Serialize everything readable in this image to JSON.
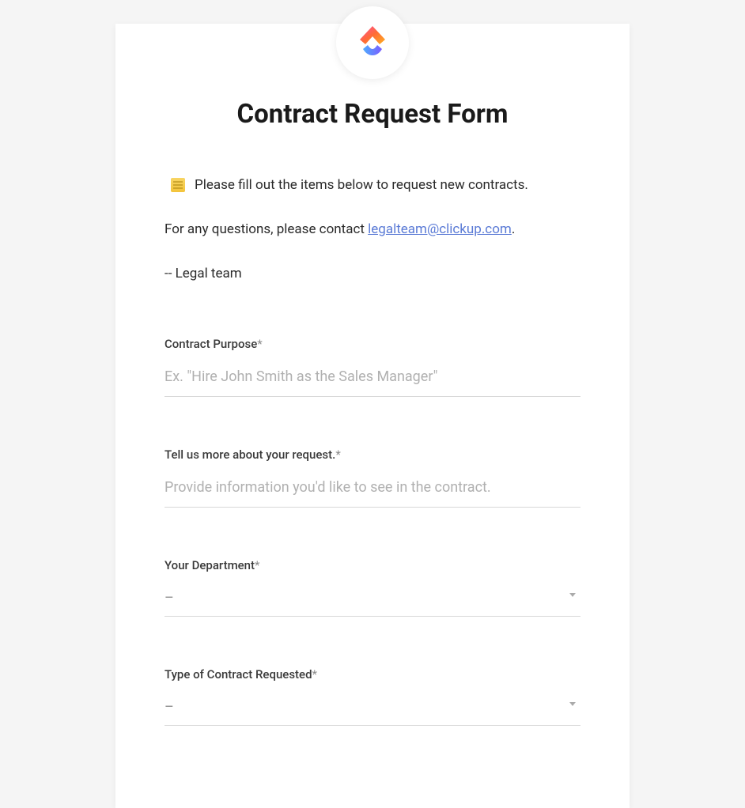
{
  "form": {
    "title": "Contract Request Form",
    "intro": "Please fill out the items below to request new contracts.",
    "contact_prefix": "For any questions, please contact ",
    "contact_email": "legalteam@clickup.com",
    "contact_suffix": ".",
    "signature": "-- Legal team"
  },
  "fields": {
    "purpose": {
      "label": "Contract Purpose",
      "required": "*",
      "placeholder": "Ex. \"Hire John Smith as the Sales Manager\""
    },
    "details": {
      "label": "Tell us more about your request.",
      "required": "*",
      "placeholder": "Provide information you'd like to see in the contract."
    },
    "department": {
      "label": "Your Department",
      "required": "*",
      "value": "–"
    },
    "contract_type": {
      "label": "Type of Contract Requested",
      "required": "*",
      "value": "–"
    }
  }
}
